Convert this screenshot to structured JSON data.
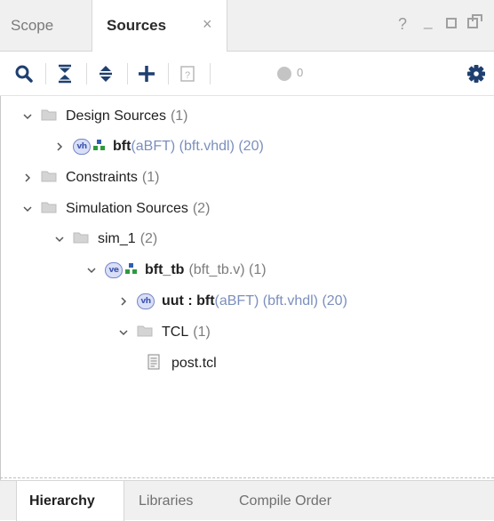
{
  "tabs": {
    "scope_label": "Scope",
    "sources_label": "Sources",
    "close_glyph": "×"
  },
  "window_controls": {
    "help": "?",
    "minimize": "_"
  },
  "toolbar": {
    "icons": [
      "search-icon",
      "collapse-all-icon",
      "expand-all-icon",
      "add-icon",
      "unknown-help-icon",
      "status-circle-icon",
      "gear-icon"
    ],
    "status_count": "0",
    "accent_color": "#1f3f70"
  },
  "tree": {
    "design_sources": {
      "label": "Design Sources",
      "count": "(1)"
    },
    "bft": {
      "name": "bft",
      "detail": "(aBFT) (bft.vhdl) (20)",
      "icon_text": "vh"
    },
    "constraints": {
      "label": "Constraints",
      "count": "(1)"
    },
    "simulation_sources": {
      "label": "Simulation Sources",
      "count": "(2)"
    },
    "sim_1": {
      "label": "sim_1",
      "count": "(2)"
    },
    "bft_tb": {
      "name": "bft_tb",
      "detail": "(bft_tb.v) (1)",
      "icon_text": "ve"
    },
    "uut": {
      "name": "uut : bft",
      "detail": "(aBFT) (bft.vhdl) (20)",
      "icon_text": "vh"
    },
    "tcl": {
      "label": "TCL",
      "count": "(1)"
    },
    "post_tcl": {
      "label": "post.tcl"
    }
  },
  "bottom_tabs": {
    "hierarchy": "Hierarchy",
    "libraries": "Libraries",
    "compile_order": "Compile Order"
  }
}
